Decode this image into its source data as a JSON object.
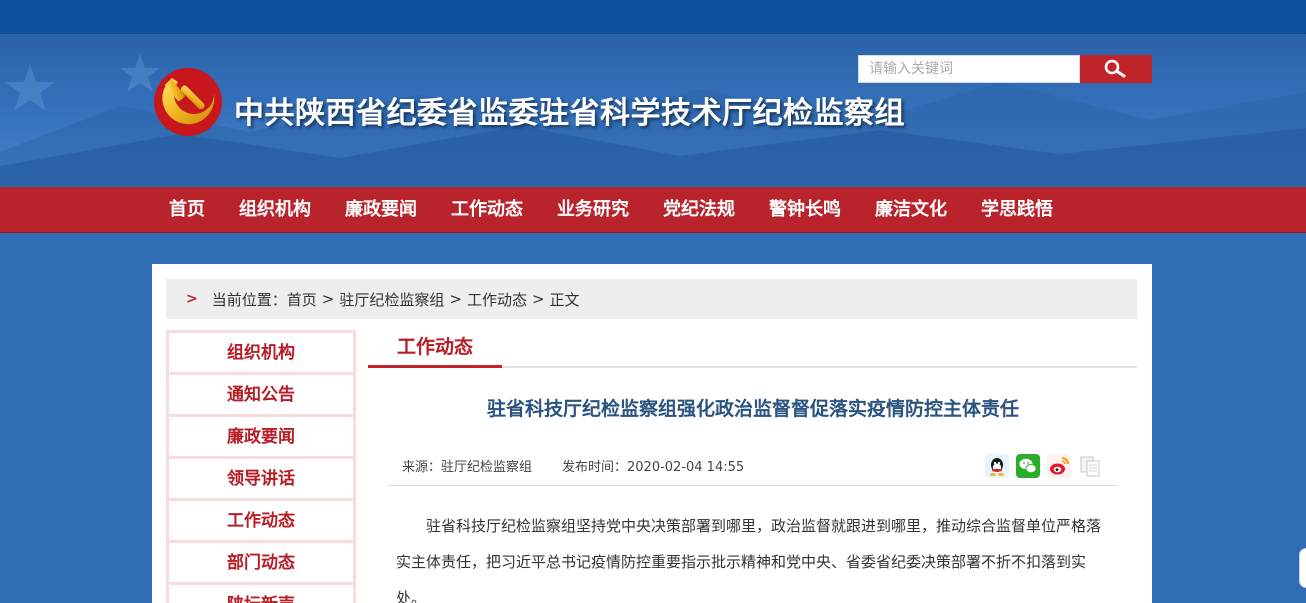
{
  "header": {
    "site_title": "中共陕西省纪委省监委驻省科学技术厅纪检监察组",
    "search_placeholder": "请输入关键词"
  },
  "nav": {
    "items": [
      "首页",
      "组织机构",
      "廉政要闻",
      "工作动态",
      "业务研究",
      "党纪法规",
      "警钟长鸣",
      "廉洁文化",
      "学思践悟"
    ]
  },
  "breadcrumb": {
    "label": "当前位置：",
    "items": [
      "首页",
      "驻厅纪检监察组",
      "工作动态",
      "正文"
    ],
    "separator": ">"
  },
  "sidebar": {
    "items": [
      "组织机构",
      "通知公告",
      "廉政要闻",
      "领导讲话",
      "工作动态",
      "部门动态",
      "陕坛新声"
    ]
  },
  "section": {
    "tab": "工作动态"
  },
  "article": {
    "title": "驻省科技厅纪检监察组强化政治监督督促落实疫情防控主体责任",
    "source": "来源：驻厅纪检监察组",
    "published": "发布时间：2020-02-04 14:55",
    "paragraph": "驻省科技厅纪检监察组坚持党中央决策部署到哪里，政治监督就跟进到哪里，推动综合监督单位严格落实主体责任，把习近平总书记疫情防控重要指示批示精神和党中央、省委省纪委决策部署不折不扣落到实处。"
  },
  "share_icons": [
    "qq-icon",
    "wechat-icon",
    "weibo-icon",
    "copy-icon"
  ],
  "colors": {
    "nav_red": "#b9232c",
    "accent_red": "#c0252b",
    "title_blue": "#2a5380",
    "background_blue": "#2f6db4"
  }
}
